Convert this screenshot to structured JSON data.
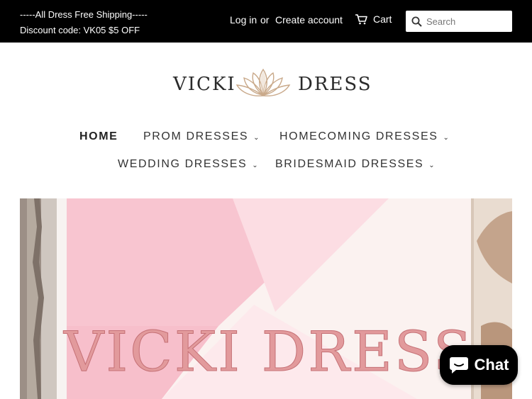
{
  "announcement": {
    "line1": "-----All Dress Free Shipping-----",
    "line2": "Discount code: VK05 $5 OFF"
  },
  "account": {
    "login": "Log in",
    "or": "or",
    "create": "Create account"
  },
  "cart": {
    "label": "Cart",
    "icon": "cart-icon"
  },
  "search": {
    "placeholder": "Search",
    "icon": "search-icon"
  },
  "logo": {
    "left": "VICKI",
    "right": "DRESS",
    "icon": "lotus-icon",
    "color": "#c9a98a"
  },
  "nav": {
    "items": [
      {
        "label": "HOME",
        "active": true,
        "dropdown": false
      },
      {
        "label": "PROM DRESSES",
        "active": false,
        "dropdown": true
      },
      {
        "label": "HOMECOMING DRESSES",
        "active": false,
        "dropdown": true
      },
      {
        "label": "WEDDING DRESSES",
        "active": false,
        "dropdown": true
      },
      {
        "label": "BRIDESMAID DRESSES",
        "active": false,
        "dropdown": true
      }
    ],
    "chevron": "⌄"
  },
  "hero": {
    "title": "VICKI DRESS",
    "text_color": "#e29a9c",
    "panel_color": "#f9c5cf"
  },
  "chat": {
    "label": "Chat",
    "icon": "chat-bubble-icon"
  }
}
